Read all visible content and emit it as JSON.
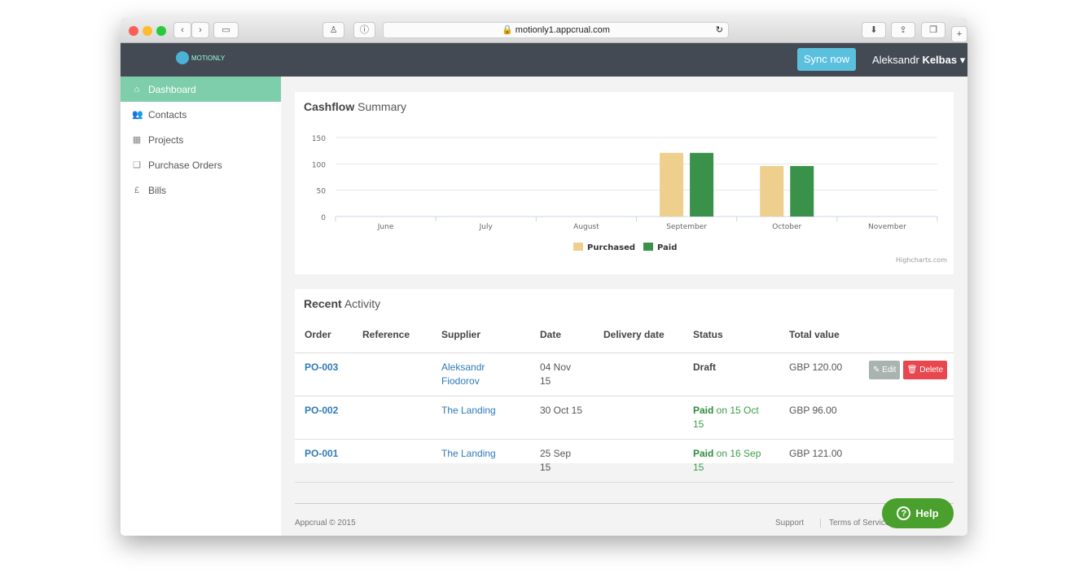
{
  "browser": {
    "url": "motionly1.appcrual.com"
  },
  "navbar": {
    "logo_text": "MOTIONLY",
    "sync_label": "Sync now",
    "user_first": "Aleksandr",
    "user_last": "Kelbas"
  },
  "sidebar": {
    "items": [
      {
        "label": "Dashboard",
        "icon": "home-icon"
      },
      {
        "label": "Contacts",
        "icon": "users-icon"
      },
      {
        "label": "Projects",
        "icon": "briefcase-icon"
      },
      {
        "label": "Purchase Orders",
        "icon": "orders-icon"
      },
      {
        "label": "Bills",
        "icon": "pound-icon"
      }
    ]
  },
  "cashflow": {
    "title_bold": "Cashflow",
    "title_rest": "Summary",
    "credit": "Highcharts.com"
  },
  "chart_data": {
    "type": "bar",
    "categories": [
      "June",
      "July",
      "August",
      "September",
      "October",
      "November"
    ],
    "series": [
      {
        "name": "Purchased",
        "color": "#eecf8e",
        "values": [
          0,
          0,
          0,
          121,
          96,
          0
        ]
      },
      {
        "name": "Paid",
        "color": "#3a924a",
        "values": [
          0,
          0,
          0,
          121,
          96,
          0
        ]
      }
    ],
    "yticks": [
      0,
      50,
      100,
      150
    ],
    "ylim": [
      0,
      150
    ],
    "grid": true,
    "legend": "bottom"
  },
  "activity": {
    "title_bold": "Recent",
    "title_rest": "Activity",
    "columns": [
      "Order",
      "Reference",
      "Supplier",
      "Date",
      "Delivery date",
      "Status",
      "Total value"
    ],
    "rows": [
      {
        "order": "PO-003",
        "reference": "",
        "supplier": "Aleksandr Fiodorov",
        "date": "04 Nov 15",
        "delivery": "",
        "status": "Draft",
        "status_detail": "",
        "total": "GBP 120.00",
        "edit": "Edit",
        "delete": "Delete"
      },
      {
        "order": "PO-002",
        "reference": "",
        "supplier": "The Landing",
        "date": "30 Oct 15",
        "delivery": "",
        "status": "Paid",
        "status_detail": " on 15 Oct 15",
        "total": "GBP 96.00"
      },
      {
        "order": "PO-001",
        "reference": "",
        "supplier": "The Landing",
        "date": "25 Sep 15",
        "delivery": "",
        "status": "Paid",
        "status_detail": " on 16 Sep 15",
        "total": "GBP 121.00"
      }
    ]
  },
  "footer": {
    "copyright": "Appcrual © 2015",
    "support": "Support",
    "terms": "Terms of Service"
  },
  "help": {
    "label": "Help"
  }
}
